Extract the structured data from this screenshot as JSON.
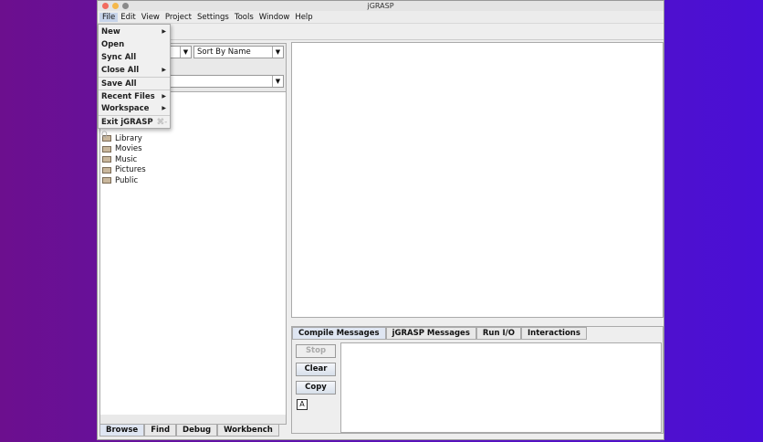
{
  "window": {
    "title": "jGRASP"
  },
  "menubar": [
    "File",
    "Edit",
    "View",
    "Project",
    "Settings",
    "Tools",
    "Window",
    "Help"
  ],
  "file_menu": {
    "items": [
      {
        "label": "New",
        "submenu": true
      },
      {
        "label": "Open"
      },
      {
        "label": "Sync All"
      },
      {
        "label": "Close All",
        "submenu": true
      },
      {
        "label": "Save All"
      },
      {
        "label": "Recent Files",
        "submenu": true
      },
      {
        "label": "Workspace",
        "submenu": true
      },
      {
        "label": "Exit jGRASP",
        "shortcut": "⌘-Q"
      }
    ]
  },
  "browse": {
    "sort": "Sort By Name",
    "folders": [
      "Library",
      "Movies",
      "Music",
      "Pictures",
      "Public"
    ]
  },
  "left_tabs": [
    "Browse",
    "Find",
    "Debug",
    "Workbench"
  ],
  "message_tabs": [
    "Compile Messages",
    "jGRASP Messages",
    "Run I/O",
    "Interactions"
  ],
  "buttons": {
    "stop": "Stop",
    "clear": "Clear",
    "copy": "Copy",
    "font": "A"
  }
}
